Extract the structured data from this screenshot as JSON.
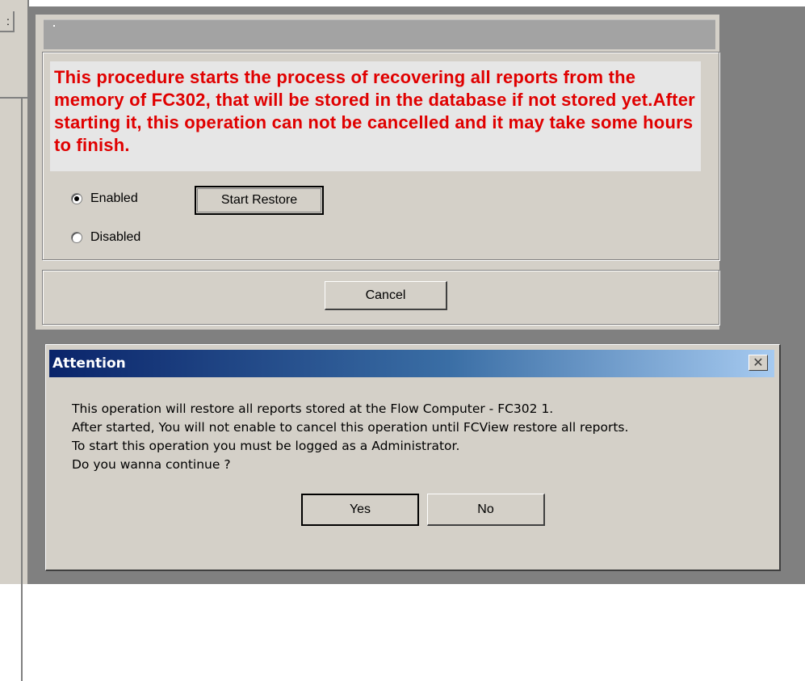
{
  "restore_window": {
    "title": "",
    "warning": "This procedure starts the process of recovering all reports from the memory of FC302, that will be stored in the database if not stored yet.After starting it, this operation can not be cancelled and it may take some hours to finish.",
    "options": [
      {
        "label": "Enabled",
        "selected": true
      },
      {
        "label": "Disabled",
        "selected": false
      }
    ],
    "start_restore_label": "Start Restore",
    "cancel_label": "Cancel",
    "warning_color": "#e00000"
  },
  "attention_dialog": {
    "title": "Attention",
    "close_glyph": "✕",
    "message_lines": [
      "This operation will restore all reports stored at the Flow Computer - FC302 1.",
      "After started, You will not enable to cancel this operation until FCView restore all reports.",
      "To start this operation you must be logged as a Administrator.",
      "Do you wanna continue ?"
    ],
    "yes_label": "Yes",
    "no_label": "No"
  },
  "colors": {
    "dialog_face": "#d4d0c8",
    "background": "#808080",
    "titlebar_start": "#0a246a",
    "titlebar_end": "#a6caf0"
  }
}
